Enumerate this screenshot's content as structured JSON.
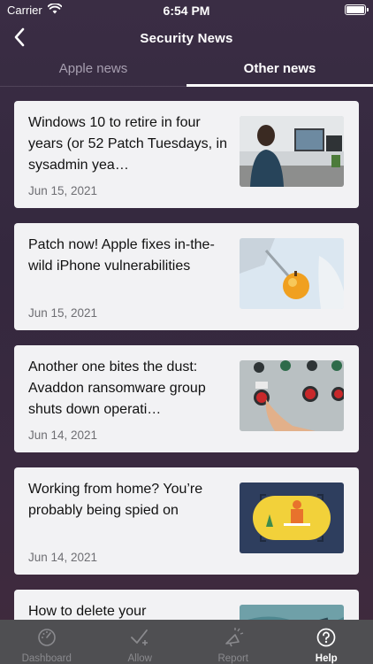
{
  "status": {
    "carrier": "Carrier",
    "time": "6:54 PM"
  },
  "nav": {
    "title": "Security News",
    "back_icon": "chevron-left-icon"
  },
  "tabs": [
    {
      "label": "Apple news",
      "active": false
    },
    {
      "label": "Other news",
      "active": true
    }
  ],
  "articles": [
    {
      "title": "Windows 10 to retire in four years (or 52 Patch Tuesdays, in sysadmin yea…",
      "date": "Jun 15, 2021",
      "image": "person-at-computer-photo"
    },
    {
      "title": "Patch now! Apple fixes in-the-wild iPhone vulnerabilities",
      "date": "Jun 15, 2021",
      "image": "apple-syringe-photo"
    },
    {
      "title": "Another one bites the dust: Avaddon ransomware group shuts down operati…",
      "date": "Jun 14, 2021",
      "image": "stop-button-panel-photo"
    },
    {
      "title": "Working from home? You’re probably being spied on",
      "date": "Jun 14, 2021",
      "image": "binoculars-surveillance-illustration"
    },
    {
      "title": "How to delete your",
      "date": "",
      "image": "partial-photo"
    }
  ],
  "tabbar": [
    {
      "label": "Dashboard",
      "icon": "gauge-icon",
      "active": false
    },
    {
      "label": "Allow",
      "icon": "checkmark-plus-icon",
      "active": false
    },
    {
      "label": "Report",
      "icon": "megaphone-icon",
      "active": false
    },
    {
      "label": "Help",
      "icon": "question-circle-icon",
      "active": true
    }
  ]
}
